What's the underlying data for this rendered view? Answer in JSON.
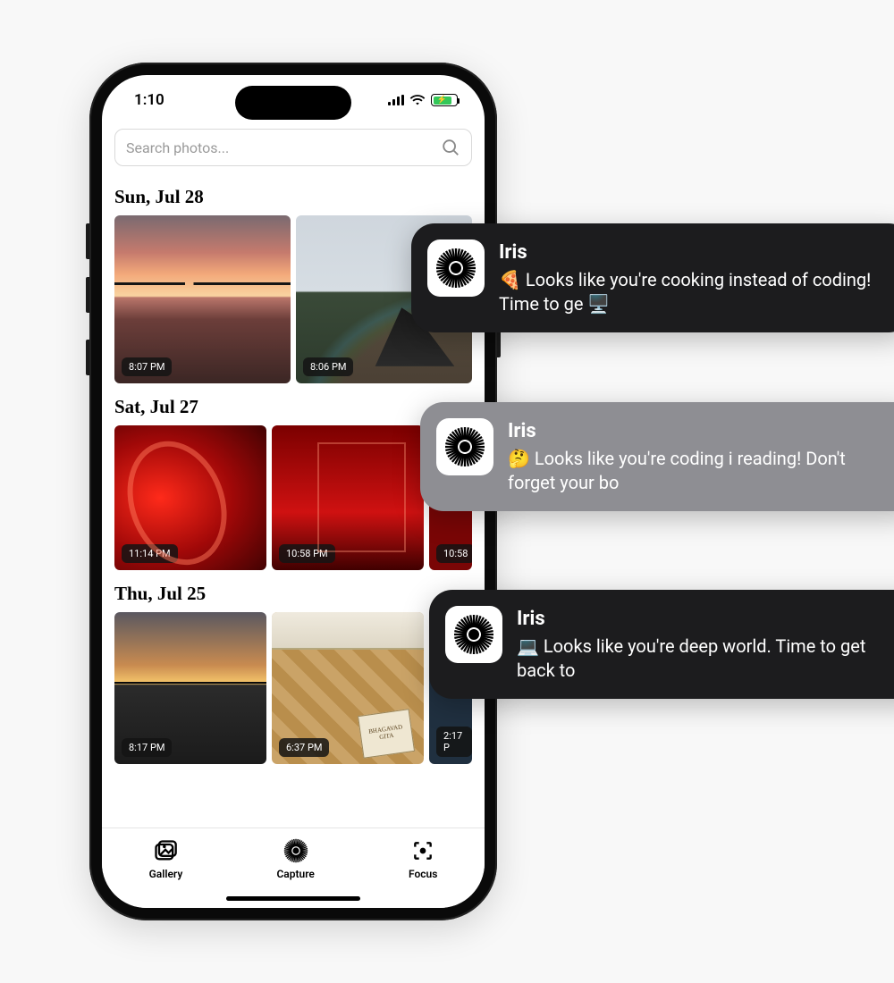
{
  "status": {
    "time": "1:10"
  },
  "search": {
    "placeholder": "Search photos..."
  },
  "gallery": {
    "sections": [
      {
        "date": "Sun, Jul 28",
        "photos": [
          {
            "time": "8:07 PM"
          },
          {
            "time": "8:06 PM"
          }
        ]
      },
      {
        "date": "Sat, Jul 27",
        "photos": [
          {
            "time": "11:14 PM"
          },
          {
            "time": "10:58 PM"
          },
          {
            "time": "10:58"
          }
        ]
      },
      {
        "date": "Thu, Jul 25",
        "photos": [
          {
            "time": "8:17 PM",
            "book": "BHAGAVAD GITA"
          },
          {
            "time": "6:37 PM"
          },
          {
            "time": "2:17 P"
          }
        ]
      }
    ]
  },
  "tabs": {
    "gallery": "Gallery",
    "capture": "Capture",
    "focus": "Focus"
  },
  "notifications": [
    {
      "app": "Iris",
      "text": "🍕 Looks like you're cooking instead of coding! Time to ge 🖥️"
    },
    {
      "app": "Iris",
      "text": "🤔 Looks like you're coding i reading! Don't forget your bo"
    },
    {
      "app": "Iris",
      "text": "💻 Looks like you're deep world. Time to get back to"
    }
  ]
}
